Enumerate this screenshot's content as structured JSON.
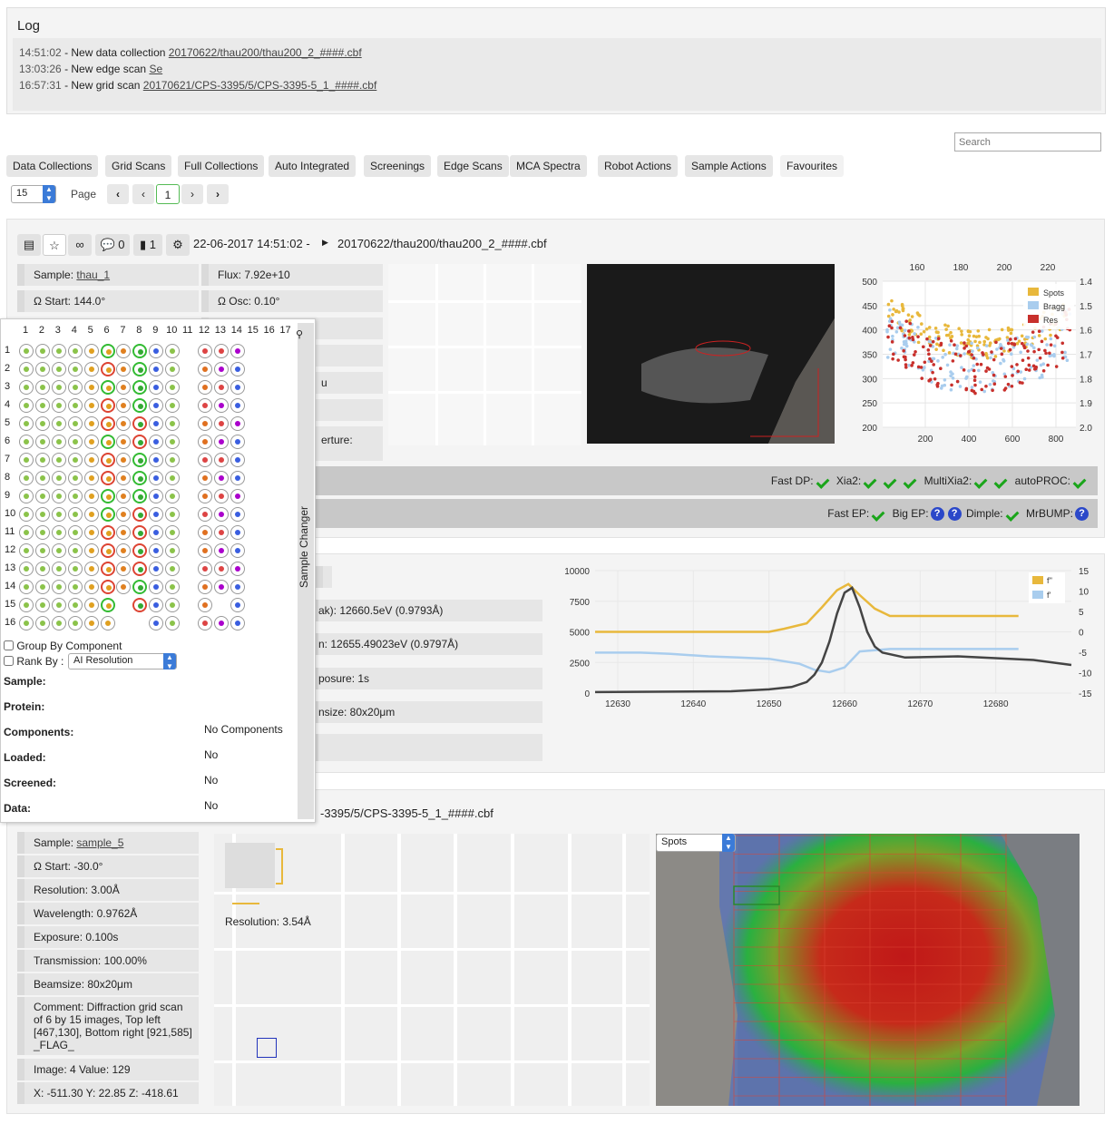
{
  "log": {
    "title": "Log",
    "entries": [
      {
        "time": "14:51:02",
        "text": "- New data collection",
        "link": "20170622/thau200/thau200_2_####.cbf"
      },
      {
        "time": "13:03:26",
        "text": "- New edge scan",
        "link": "Se"
      },
      {
        "time": "16:57:31",
        "text": "- New grid scan",
        "link": "20170621/CPS-3395/5/CPS-3395-5_1_####.cbf"
      }
    ]
  },
  "search": {
    "placeholder": "Search"
  },
  "tabs": [
    "Data Collections",
    "Grid Scans",
    "Full Collections",
    "Auto Integrated",
    "Screenings",
    "Edge Scans",
    "MCA Spectra",
    "Robot Actions",
    "Sample Actions",
    "Favourites"
  ],
  "pager": {
    "per_page": "15",
    "page_label": "Page",
    "current": "1",
    "first": "‹‹",
    "prev": "‹",
    "next": "›",
    "last": "››"
  },
  "dc1": {
    "comments": "0",
    "attachments": "1",
    "datetime": "22-06-2017 14:51:02 -",
    "path": "20170622/thau200/thau200_2_####.cbf",
    "sample_label": "Sample:",
    "sample": "thau_1",
    "flux": "Flux: 7.92e+10",
    "ostart": "Ω Start: 144.0°",
    "oosc": "Ω Osc: 0.10°",
    "aperture": "erture:",
    "partial": "u",
    "fastdp": "Fast DP:",
    "xia2": "Xia2:",
    "multixia2": "MultiXia2:",
    "autoproc": "autoPROC:",
    "fastep": "Fast EP:",
    "bigep": "Big EP:",
    "dimple": "Dimple:",
    "mrbump": "MrBUMP:",
    "q": "?"
  },
  "edge": {
    "peak": "ak): 12660.5eV (0.9793Å)",
    "inflection": "n: 12655.49023eV (0.9797Å)",
    "exposure": "posure: 1s",
    "beamsize": "nsize: 80x20μm"
  },
  "grid": {
    "path": "-3395/5/CPS-3395-5_1_####.cbf",
    "sample_label": "Sample:",
    "sample": "sample_5",
    "ostart": "Ω Start: -30.0°",
    "resolution": "Resolution: 3.00Å",
    "wavelength": "Wavelength: 0.9762Å",
    "exposure": "Exposure: 0.100s",
    "transmission": "Transmission: 100.00%",
    "beamsize": "Beamsize: 80x20μm",
    "comment": "Comment: Diffraction grid scan of 6 by 15 images, Top left [467,130], Bottom right [921,585] _FLAG_",
    "image_value": "Image: 4 Value: 129",
    "xyz": "X: -511.30 Y: 22.85 Z: -418.61",
    "det_resolution": "Resolution: 3.54Å",
    "heat_select": "Spots"
  },
  "sample_changer": {
    "title": "Sample Changer",
    "cols": [
      "1",
      "2",
      "3",
      "4",
      "5",
      "6",
      "7",
      "8",
      "9",
      "10",
      "11",
      "12",
      "13",
      "14",
      "15",
      "16",
      "17"
    ],
    "rows": [
      "1",
      "2",
      "3",
      "4",
      "5",
      "6",
      "7",
      "8",
      "9",
      "10",
      "11",
      "12",
      "13",
      "14",
      "15",
      "16"
    ],
    "group_label": "Group By Component",
    "rank_label": "Rank By :",
    "rank_value": "AI Resolution",
    "fields": [
      {
        "label": "Sample:",
        "value": ""
      },
      {
        "label": "Protein:",
        "value": ""
      },
      {
        "label": "Components:",
        "value": "No Components"
      },
      {
        "label": "Loaded:",
        "value": "No"
      },
      {
        "label": "Screened:",
        "value": "No"
      },
      {
        "label": "Data:",
        "value": "No"
      }
    ]
  },
  "chart_data": [
    {
      "type": "scatter",
      "title": "",
      "x_top_ticks": [
        "160",
        "180",
        "200",
        "220"
      ],
      "x_bottom_ticks": [
        "200",
        "400",
        "600",
        "800"
      ],
      "y_left_ticks": [
        "500",
        "450",
        "400",
        "350",
        "300",
        "250",
        "200"
      ],
      "y_right_ticks": [
        "1.4",
        "1.5",
        "1.6",
        "1.7",
        "1.8",
        "1.9",
        "2.0"
      ],
      "ylim": [
        200,
        500
      ],
      "xlim": [
        40,
        900
      ],
      "series": [
        {
          "name": "Spots",
          "color": "#e8b83c"
        },
        {
          "name": "Bragg",
          "color": "#a9cdee"
        },
        {
          "name": "Res",
          "color": "#c8302c"
        }
      ]
    },
    {
      "type": "line",
      "x_ticks": [
        "12630",
        "12640",
        "12650",
        "12660",
        "12670",
        "12680"
      ],
      "y_left_ticks": [
        "10000",
        "7500",
        "5000",
        "2500",
        "0"
      ],
      "y_right_ticks": [
        "15",
        "10",
        "5",
        "0",
        "-5",
        "-10",
        "-15"
      ],
      "xlim": [
        12627,
        12690
      ],
      "ylim": [
        0,
        10000
      ],
      "series": [
        {
          "name": "f''",
          "color": "#e8b83c",
          "x": [
            12627,
            12650,
            12652,
            12655,
            12657,
            12659,
            12660.5,
            12662,
            12664,
            12666,
            12683
          ],
          "y": [
            5000,
            5000,
            5250,
            5700,
            7000,
            8400,
            8900,
            8000,
            6900,
            6300,
            6300
          ]
        },
        {
          "name": "f'",
          "color": "#a9cdee",
          "x": [
            12627,
            12633,
            12637,
            12642,
            12646,
            12650,
            12654,
            12656,
            12658,
            12660,
            12662,
            12666,
            12683
          ],
          "y": [
            3300,
            3300,
            3200,
            3000,
            2900,
            2800,
            2400,
            1900,
            1700,
            2100,
            3400,
            3600,
            3600
          ]
        },
        {
          "name": "",
          "color": "#444",
          "x": [
            12627,
            12645,
            12650,
            12653,
            12655,
            12656,
            12657,
            12658,
            12659,
            12660,
            12661,
            12662,
            12663,
            12664,
            12665,
            12668,
            12675,
            12685,
            12690
          ],
          "y": [
            80,
            150,
            300,
            500,
            900,
            1500,
            2500,
            4200,
            6500,
            8200,
            8600,
            7000,
            5000,
            3800,
            3300,
            2900,
            3000,
            2700,
            2300
          ]
        }
      ]
    }
  ]
}
